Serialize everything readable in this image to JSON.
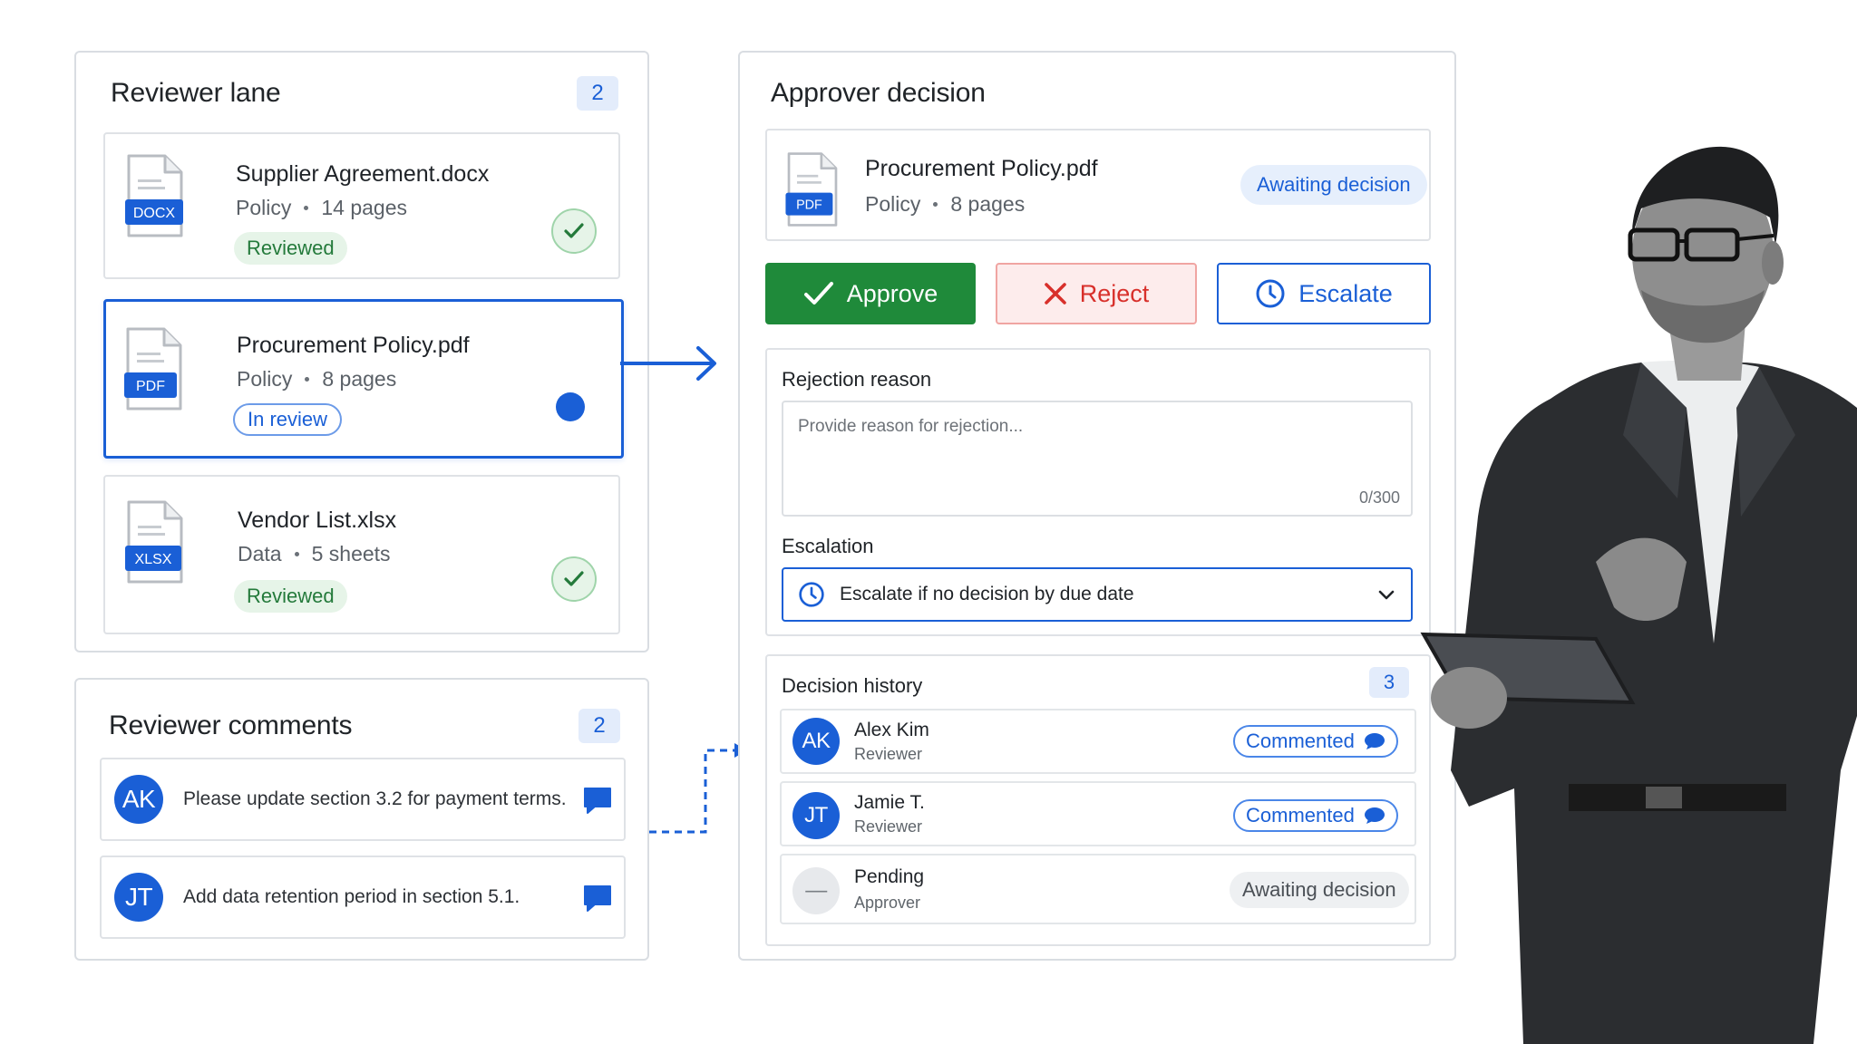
{
  "reviewer_lane": {
    "title": "Reviewer lane",
    "count": "2",
    "files": [
      {
        "name": "Supplier Agreement.docx",
        "type_label": "DOCX",
        "category": "Policy",
        "size": "14 pages",
        "status": "Reviewed"
      },
      {
        "name": "Procurement Policy.pdf",
        "type_label": "PDF",
        "category": "Policy",
        "size": "8 pages",
        "status": "In review"
      },
      {
        "name": "Vendor List.xlsx",
        "type_label": "XLSX",
        "category": "Data",
        "size": "5 sheets",
        "status": "Reviewed"
      }
    ]
  },
  "reviewer_comments": {
    "title": "Reviewer comments",
    "count": "2",
    "items": [
      {
        "initials": "AK",
        "text": "Please update section 3.2 for payment terms."
      },
      {
        "initials": "JT",
        "text": "Add data retention period in section 5.1."
      }
    ]
  },
  "approver": {
    "title": "Approver decision",
    "document": {
      "name": "Procurement Policy.pdf",
      "type_label": "PDF",
      "category": "Policy",
      "size": "8 pages",
      "status": "Awaiting decision"
    },
    "actions": {
      "approve": "Approve",
      "reject": "Reject",
      "escalate": "Escalate"
    },
    "rejection": {
      "label": "Rejection reason",
      "placeholder": "Provide reason for rejection...",
      "counter": "0/300"
    },
    "escalation": {
      "label": "Escalation",
      "value": "Escalate if no decision by due date"
    },
    "history": {
      "title": "Decision history",
      "count": "3",
      "entries": [
        {
          "initials": "AK",
          "name": "Alex Kim",
          "role": "Reviewer",
          "status": "Commented"
        },
        {
          "initials": "JT",
          "name": "Jamie T.",
          "role": "Reviewer",
          "status": "Commented"
        },
        {
          "initials": "—",
          "name": "Pending",
          "role": "Approver",
          "status": "Awaiting decision"
        }
      ]
    }
  },
  "icons": {
    "file": "document-icon",
    "check": "check-icon",
    "x": "x-icon",
    "clock": "clock-icon",
    "chevron": "chevron-down-icon",
    "chat": "chat-bubble-icon"
  },
  "colors": {
    "accent": "#1a5fd6",
    "approve": "#1f8a3a",
    "reject": "#d8302b",
    "reviewed": "#247a3b"
  }
}
